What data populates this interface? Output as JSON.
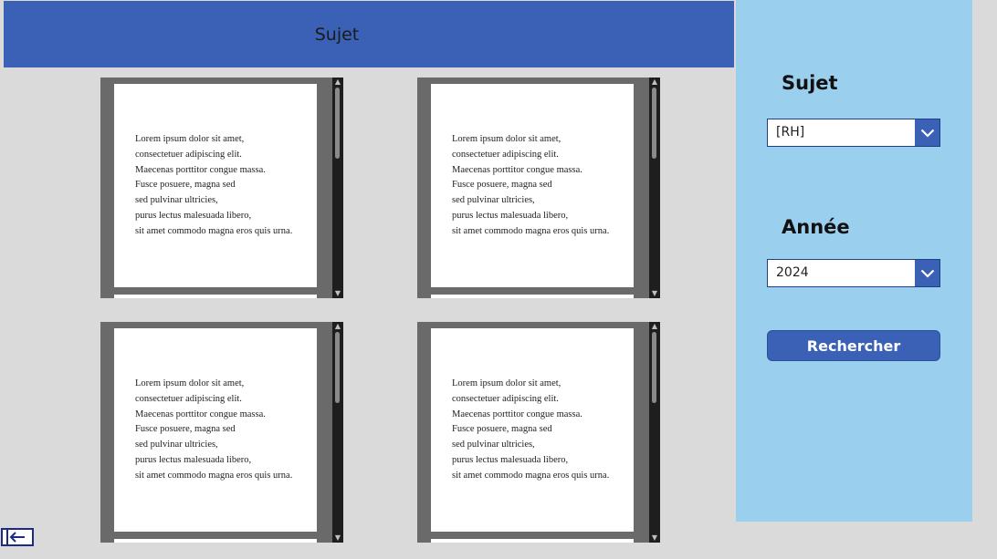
{
  "header": {
    "title": "Sujet"
  },
  "filters": {
    "subject_label": "Sujet",
    "subject_value": "[RH]",
    "year_label": "Année",
    "year_value": "2024",
    "search_label": "Rechercher"
  },
  "documents": [
    {
      "lines": [
        "Lorem ipsum dolor sit amet,",
        "consectetuer adipiscing elit.",
        "Maecenas porttitor congue massa.",
        "Fusce posuere, magna sed",
        "sed pulvinar ultricies,",
        "purus lectus malesuada libero,",
        "sit amet commodo magna eros quis urna."
      ]
    },
    {
      "lines": [
        "Lorem ipsum dolor sit amet,",
        "consectetuer adipiscing elit.",
        "Maecenas porttitor congue massa.",
        "Fusce posuere, magna sed",
        "sed pulvinar ultricies,",
        "purus lectus malesuada libero,",
        "sit amet commodo magna eros quis urna."
      ]
    },
    {
      "lines": [
        "Lorem ipsum dolor sit amet,",
        "consectetuer adipiscing elit.",
        "Maecenas porttitor congue massa.",
        "Fusce posuere, magna sed",
        "sed pulvinar ultricies,",
        "purus lectus malesuada libero,",
        "sit amet commodo magna eros quis urna."
      ]
    },
    {
      "lines": [
        "Lorem ipsum dolor sit amet,",
        "consectetuer adipiscing elit.",
        "Maecenas porttitor congue massa.",
        "Fusce posuere, magna sed",
        "sed pulvinar ultricies,",
        "purus lectus malesuada libero,",
        "sit amet commodo magna eros quis urna."
      ]
    }
  ],
  "icons": {
    "dropdown": "chevron-down-icon",
    "scroll_up": "scroll-up-arrow-icon",
    "scroll_down": "scroll-down-arrow-icon",
    "back": "arrow-left-icon"
  },
  "colors": {
    "accent": "#3a61b5",
    "panel": "#9bcfee",
    "background": "#dadada",
    "viewer": "#6a6a6a",
    "back_button_border": "#1b2a86"
  }
}
